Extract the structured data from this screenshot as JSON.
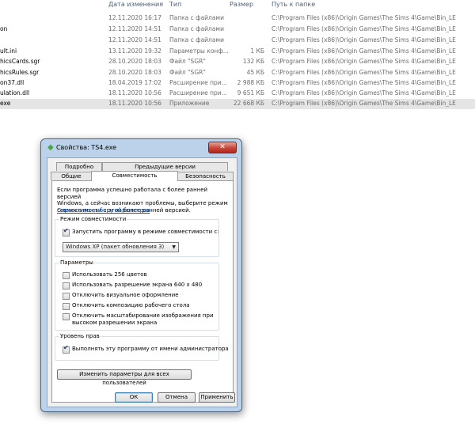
{
  "list": {
    "headers": {
      "date": "Дата изменения",
      "type": "Тип",
      "size": "Размер",
      "path": "Путь к папке"
    },
    "rows": [
      {
        "name": "",
        "date": "12.11.2020 16:17",
        "type": "Папка с файлами",
        "size": "",
        "path": "C:\\Program Files (x86)\\Origin Games\\The Sims 4\\Game\\Bin_LE"
      },
      {
        "name": "on",
        "date": "12.11.2020 14:51",
        "type": "Папка с файлами",
        "size": "",
        "path": "C:\\Program Files (x86)\\Origin Games\\The Sims 4\\Game\\Bin_LE"
      },
      {
        "name": "",
        "date": "12.11.2020 14:51",
        "type": "Папка с файлами",
        "size": "",
        "path": "C:\\Program Files (x86)\\Origin Games\\The Sims 4\\Game\\Bin_LE"
      },
      {
        "name": "ult.ini",
        "date": "13.11.2020 19:32",
        "type": "Параметры конф...",
        "size": "1 КБ",
        "path": "C:\\Program Files (x86)\\Origin Games\\The Sims 4\\Game\\Bin_LE"
      },
      {
        "name": "hicsCards.sgr",
        "date": "28.10.2020 18:03",
        "type": "Файл \"SGR\"",
        "size": "132 КБ",
        "path": "C:\\Program Files (x86)\\Origin Games\\The Sims 4\\Game\\Bin_LE"
      },
      {
        "name": "hicsRules.sgr",
        "date": "28.10.2020 18:03",
        "type": "Файл \"SGR\"",
        "size": "45 КБ",
        "path": "C:\\Program Files (x86)\\Origin Games\\The Sims 4\\Game\\Bin_LE"
      },
      {
        "name": "on37.dll",
        "date": "18.04.2019 17:02",
        "type": "Расширение при...",
        "size": "2 988 КБ",
        "path": "C:\\Program Files (x86)\\Origin Games\\The Sims 4\\Game\\Bin_LE"
      },
      {
        "name": "ulation.dll",
        "date": "18.11.2020 10:56",
        "type": "Расширение при...",
        "size": "9 651 КБ",
        "path": "C:\\Program Files (x86)\\Origin Games\\The Sims 4\\Game\\Bin_LE"
      },
      {
        "name": "exe",
        "date": "18.11.2020 10:56",
        "type": "Приложение",
        "size": "22 668 КБ",
        "path": "C:\\Program Files (x86)\\Origin Games\\The Sims 4\\Game\\Bin_LE"
      }
    ]
  },
  "dialog": {
    "title": "Свойства: TS4.exe",
    "close": "✕",
    "tabs_back": [
      "Подробно",
      "Предыдущие версии"
    ],
    "tabs_front": [
      "Общие",
      "Совместимость",
      "Безопасность"
    ],
    "intro_lines": [
      "Если программа успешно работала с более ранней версией",
      "Windows, а сейчас возникают проблемы, выберите режим",
      "совместимости с этой более ранней версией."
    ],
    "help_link": "Справка по выбору параметров",
    "compat_group": {
      "label": "Режим совместимости",
      "checkbox": "Запустить программу в режиме совместимости с:",
      "combo_value": "Windows XP (пакет обновления 3)"
    },
    "params_group": {
      "label": "Параметры",
      "items": [
        {
          "label": "Использовать 256 цветов",
          "checked": false
        },
        {
          "label": "Использовать разрешение экрана 640 х 480",
          "checked": false
        },
        {
          "label": "Отключить визуальное оформление",
          "checked": false
        },
        {
          "label": "Отключить композицию рабочего стола",
          "checked": false
        },
        {
          "label": "Отключить масштабирование изображения при",
          "label2": "высоком разрешении экрана",
          "checked": false
        }
      ]
    },
    "rights_group": {
      "label": "Уровень прав",
      "checkbox": "Выполнять эту программу от имени администратора"
    },
    "all_users_button": "Изменить параметры для всех пользователей",
    "buttons": {
      "ok": "ОК",
      "cancel": "Отмена",
      "apply": "Применить"
    }
  }
}
